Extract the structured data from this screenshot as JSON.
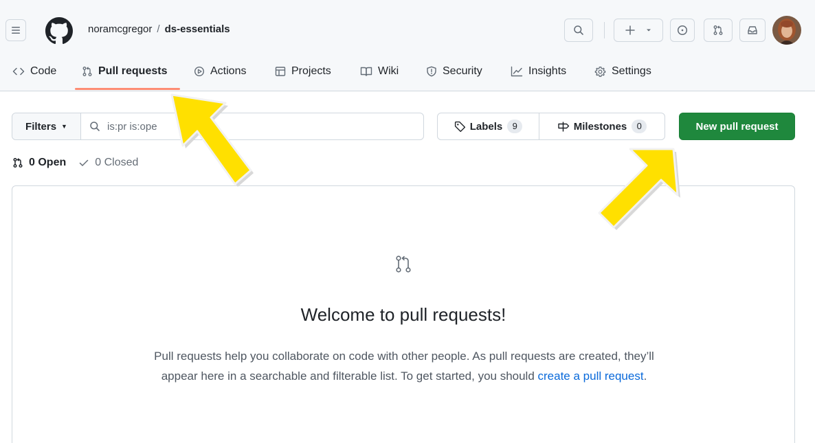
{
  "header": {
    "owner": "noramcgregor",
    "separator": "/",
    "repo": "ds-essentials",
    "icons": [
      "hamburger-icon",
      "github-logo",
      "search-icon",
      "plus-icon",
      "chevron-down-icon",
      "issue-icon",
      "pull-request-icon",
      "inbox-icon",
      "avatar"
    ]
  },
  "tabs": [
    {
      "label": "Code",
      "icon": "code-icon"
    },
    {
      "label": "Pull requests",
      "icon": "pull-request-icon",
      "active": true
    },
    {
      "label": "Actions",
      "icon": "play-icon"
    },
    {
      "label": "Projects",
      "icon": "table-icon"
    },
    {
      "label": "Wiki",
      "icon": "book-icon"
    },
    {
      "label": "Security",
      "icon": "shield-icon"
    },
    {
      "label": "Insights",
      "icon": "graph-icon"
    },
    {
      "label": "Settings",
      "icon": "gear-icon"
    }
  ],
  "toolbar": {
    "filters_label": "Filters",
    "search_value": "is:pr is:ope",
    "labels_label": "Labels",
    "labels_count": "9",
    "milestones_label": "Milestones",
    "milestones_count": "0",
    "new_pr_label": "New pull request"
  },
  "states": {
    "open_label": "0 Open",
    "closed_label": "0 Closed"
  },
  "blank_slate": {
    "title": "Welcome to pull requests!",
    "desc_line1": "Pull requests help you collaborate on code with other people. As pull requests are created, they’ll",
    "desc_line2": "appear here in a searchable and filterable list. To get started, you should ",
    "link": "create a pull request",
    "end": "."
  },
  "colors": {
    "primary_button": "#1f883d",
    "active_tab_underline": "#fd8c73",
    "link": "#0969da",
    "annotation_arrow": "#ffe000"
  }
}
